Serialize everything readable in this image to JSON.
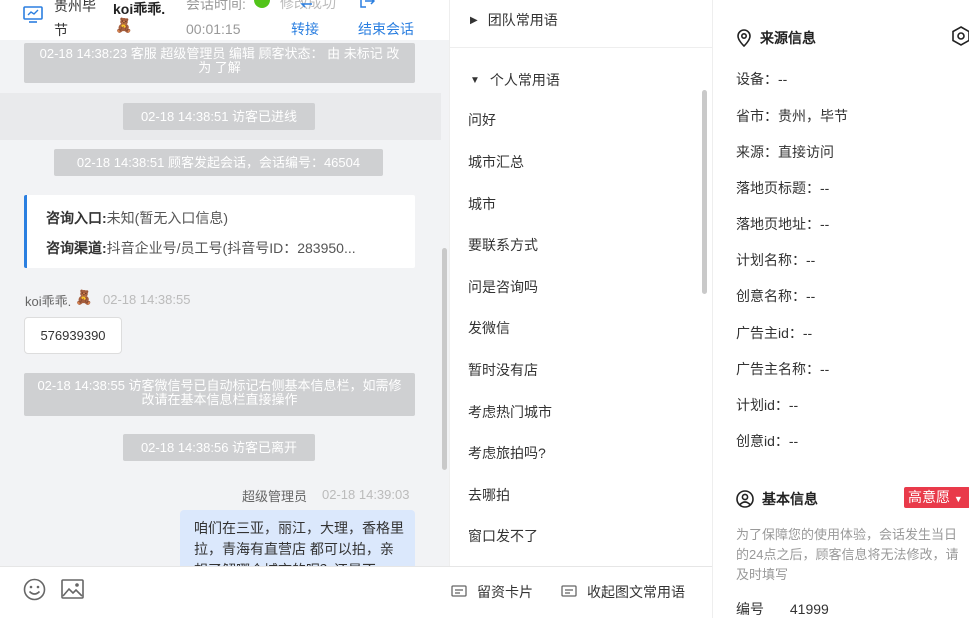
{
  "header": {
    "location": "贵州毕节",
    "visitor_name": "koi乖乖.",
    "visitor_emoji": "🧸",
    "session_time_label": "会话时间:",
    "session_time": "00:01:15",
    "toast": "修改成功",
    "transfer_label": "转接",
    "end_label": "结束会话"
  },
  "messages": {
    "sys1": "02-18 14:38:23 客服 超级管理员 编辑 顾客状态： 由 未标记 改为 了解",
    "sys2": "02-18 14:38:51 访客已进线",
    "sys3": "02-18 14:38:51 顾客发起会话，会话编号：46504",
    "entry_label": "咨询入口:",
    "entry_value": "未知(暂无入口信息)",
    "channel_label": "咨询渠道:",
    "channel_value": "抖音企业号/员工号(抖音号ID：283950...",
    "visitor_name": "koi乖乖.",
    "visitor_emoji": "🧸",
    "visitor_time": "02-18 14:38:55",
    "visitor_msg": "576939390",
    "sys4": "02-18 14:38:55 访客微信号已自动标记右侧基本信息栏，如需修改请在基本信息栏直接操作",
    "sys5": "02-18 14:38:56 访客已离开",
    "agent_name": "超级管理员",
    "agent_time": "02-18 14:39:03",
    "agent_msg": "咱们在三亚，丽江，大理，香格里拉，青海有直营店 都可以拍，亲想了解哪个城市的呢？还是不"
  },
  "footer": {
    "card_label": "留资卡片",
    "collapse_label": "收起图文常用语"
  },
  "phrases": {
    "team_group": "团队常用语",
    "personal_group": "个人常用语",
    "items": [
      "问好",
      "城市汇总",
      "城市",
      "要联系方式",
      "问是咨询吗",
      "发微信",
      "暂时没有店",
      "考虑热门城市",
      "考虑旅拍吗?",
      "去哪拍",
      "窗口发不了"
    ]
  },
  "info": {
    "source_title": "来源信息",
    "rows": [
      "设备：--",
      "省市：贵州，毕节",
      "来源：直接访问",
      "落地页标题：--",
      "落地页地址：--",
      "计划名称：--",
      "创意名称：--",
      "广告主id：--",
      "广告主名称：--",
      "计划id：--",
      "创意id：--"
    ],
    "basic_title": "基本信息",
    "intent_badge": "高意愿",
    "notice": "为了保障您的使用体验，会话发生当日的24点之后，顾客信息将无法修改，请及时填写",
    "id_label": "编号",
    "id_value": "41999"
  },
  "colors": {
    "accent": "#2b7fe0",
    "system_bubble": "#cfd0d2",
    "agent_bubble": "#dbe8fc",
    "badge_red": "#e93a4a"
  }
}
